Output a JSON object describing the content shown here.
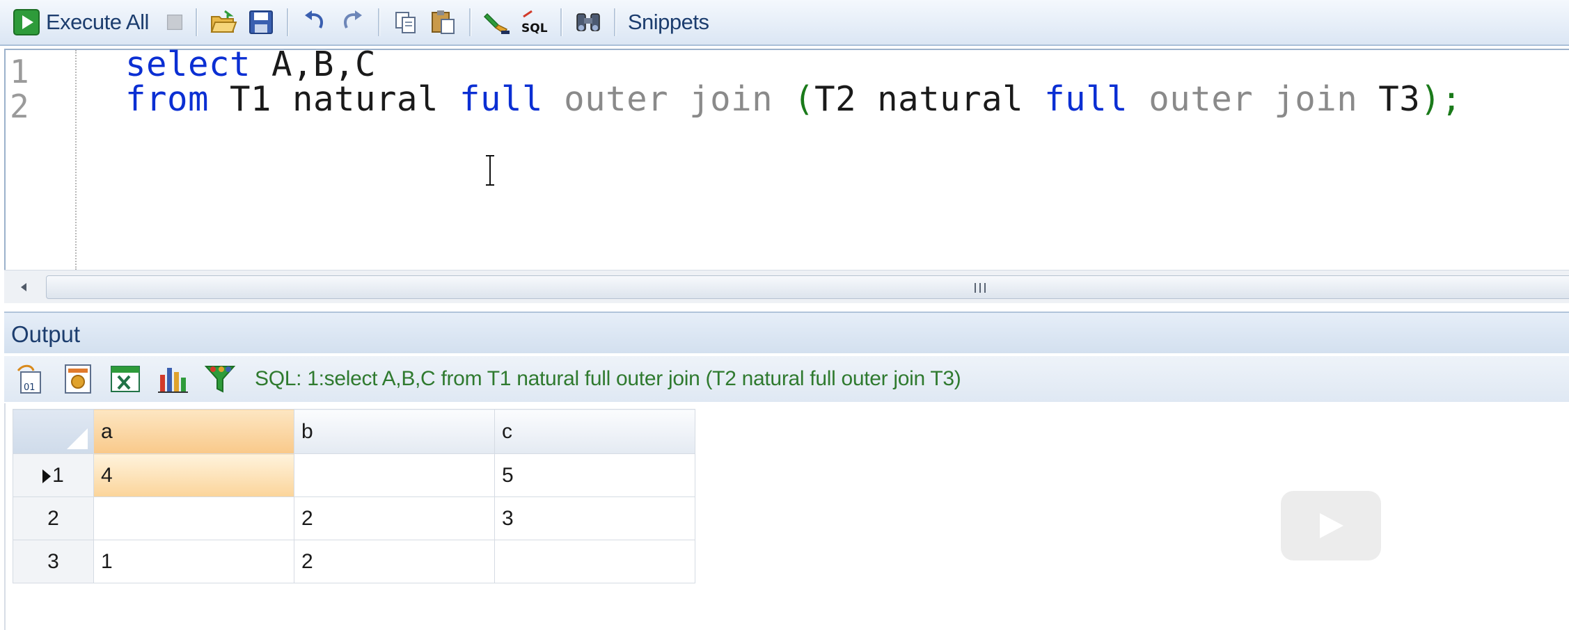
{
  "toolbar": {
    "execute_all_label": "Execute All",
    "snippets_label": "Snippets",
    "buttons": [
      "execute-all",
      "stop",
      "open",
      "save",
      "undo",
      "redo",
      "copy",
      "paste",
      "format",
      "sql",
      "find",
      "snippets"
    ]
  },
  "editor": {
    "line_numbers": [
      "1",
      "2"
    ],
    "line1": {
      "kw_select": "select",
      "rest": " A,B,C"
    },
    "line2": {
      "kw_from": "from",
      "t1": " T1 natural ",
      "kw_full1": "full",
      "kw_outer1": "outer",
      "kw_join1": "join",
      "paren_open": "(",
      "t2": "T2 natural ",
      "kw_full2": "full",
      "kw_outer2": "outer",
      "kw_join2": "join",
      "t3": " T3",
      "paren_close": ")",
      "semi": ";"
    }
  },
  "output": {
    "title": "Output",
    "sql_status": "SQL: 1:select A,B,C  from T1 natural full outer join (T2 natural full outer join T3)"
  },
  "grid": {
    "columns": [
      "a",
      "b",
      "c"
    ],
    "rows": [
      {
        "num": "1",
        "a": "4",
        "b": "",
        "c": "5"
      },
      {
        "num": "2",
        "a": "",
        "b": "2",
        "c": "3"
      },
      {
        "num": "3",
        "a": "1",
        "b": "2",
        "c": ""
      }
    ]
  },
  "colors": {
    "keyword": "#0b2fd3",
    "join_keyword": "#8a8a8a",
    "paren": "#1a7a1a",
    "sql_status": "#2f7a2f",
    "selection": "#f9c98a"
  }
}
